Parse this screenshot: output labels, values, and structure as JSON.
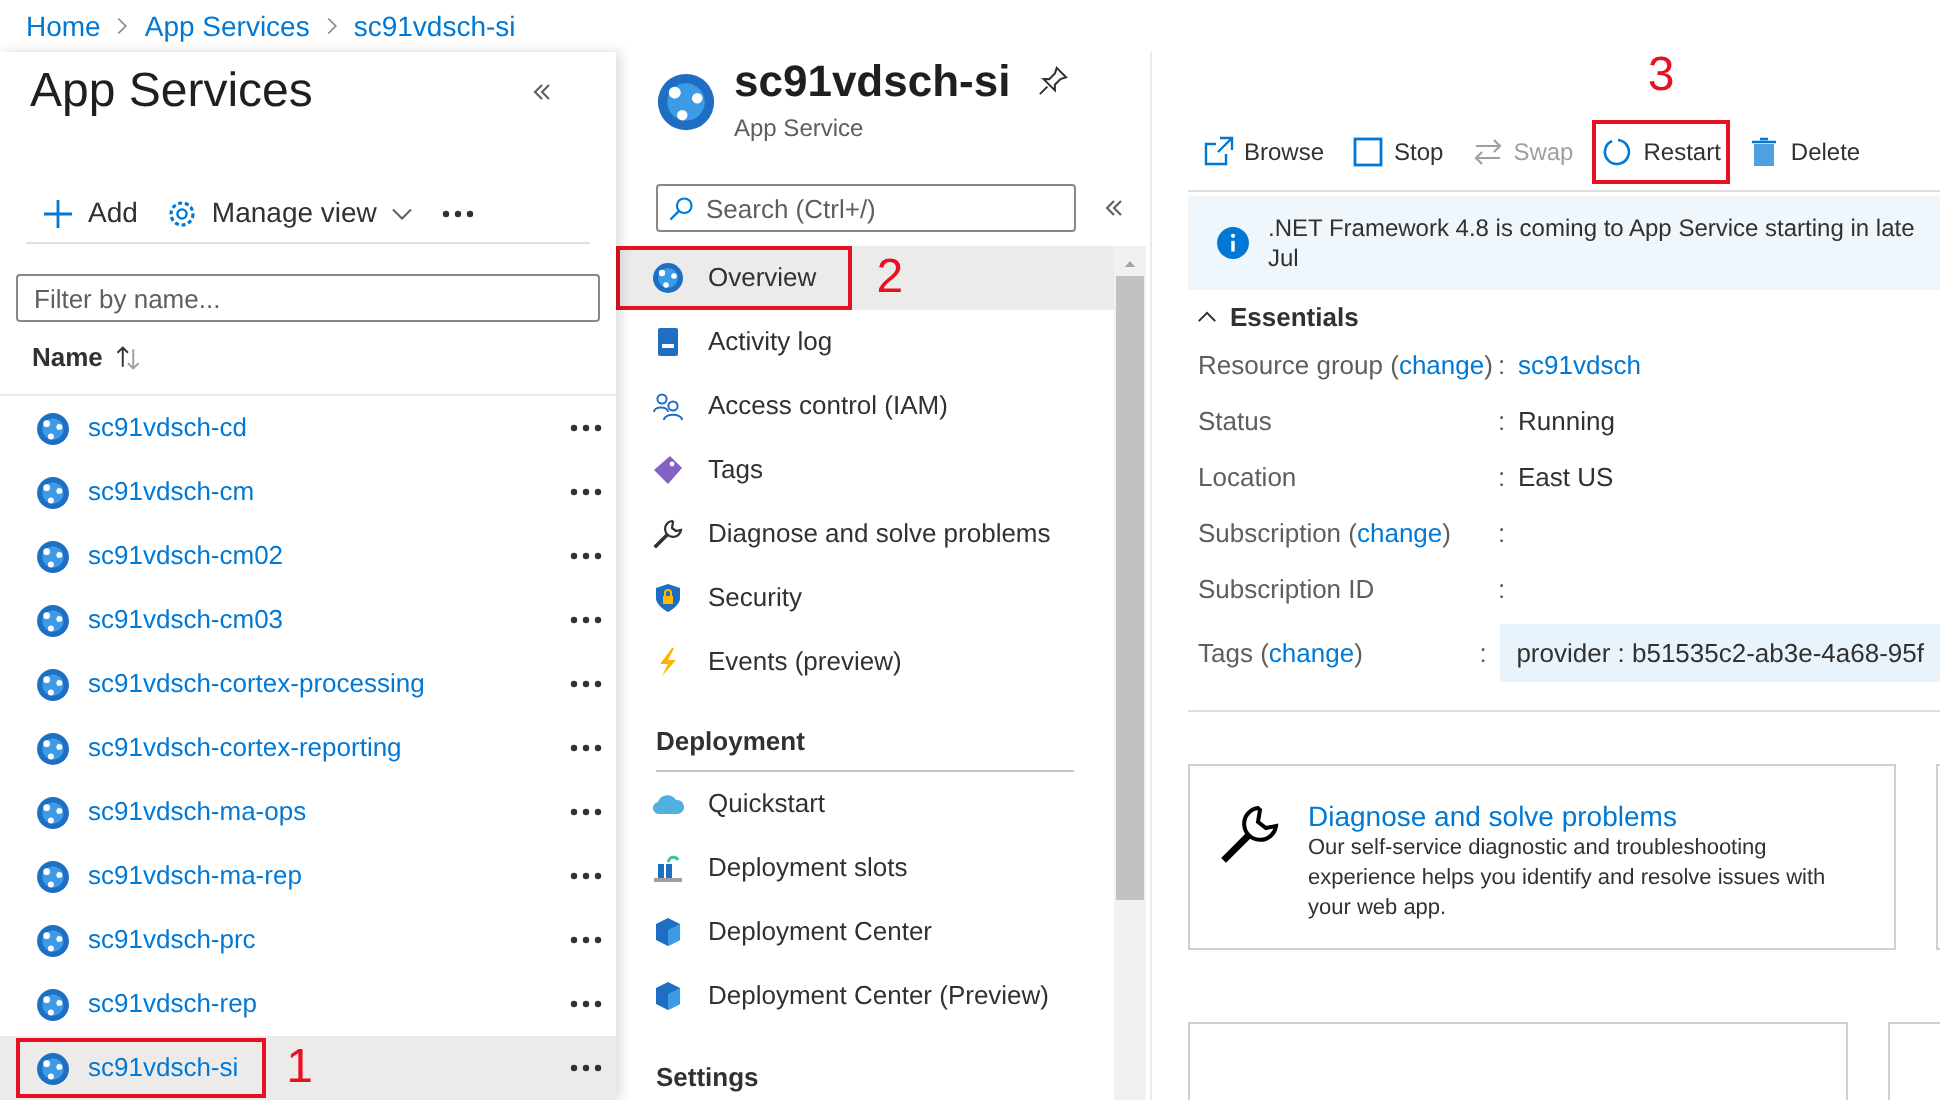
{
  "breadcrumb": [
    "Home",
    "App Services",
    "sc91vdsch-si"
  ],
  "list_blade": {
    "title": "App Services",
    "toolbar": [
      {
        "label": "Add",
        "kind": "add"
      },
      {
        "label": "Manage view",
        "kind": "manage"
      }
    ],
    "filter": {
      "placeholder": "Filter by name..."
    },
    "column": "Name",
    "rows": [
      {
        "name": "sc91vdsch-cd",
        "selected": false
      },
      {
        "name": "sc91vdsch-cm",
        "selected": false
      },
      {
        "name": "sc91vdsch-cm02",
        "selected": false
      },
      {
        "name": "sc91vdsch-cm03",
        "selected": false
      },
      {
        "name": "sc91vdsch-cortex-processing",
        "selected": false
      },
      {
        "name": "sc91vdsch-cortex-reporting",
        "selected": false
      },
      {
        "name": "sc91vdsch-ma-ops",
        "selected": false
      },
      {
        "name": "sc91vdsch-ma-rep",
        "selected": false
      },
      {
        "name": "sc91vdsch-prc",
        "selected": false
      },
      {
        "name": "sc91vdsch-rep",
        "selected": false
      },
      {
        "name": "sc91vdsch-si",
        "selected": true,
        "annotation": "1"
      }
    ]
  },
  "resource": {
    "title": "sc91vdsch-si",
    "subtitle": "App Service",
    "search": {
      "placeholder": "Search (Ctrl+/)"
    },
    "menu": [
      {
        "kind": "item",
        "label": "Overview",
        "selected": true,
        "annotation": "2"
      },
      {
        "kind": "item",
        "label": "Activity log",
        "selected": false
      },
      {
        "kind": "item",
        "label": "Access control (IAM)",
        "selected": false
      },
      {
        "kind": "item",
        "label": "Tags",
        "selected": false
      },
      {
        "kind": "item",
        "label": "Diagnose and solve problems",
        "selected": false
      },
      {
        "kind": "item",
        "label": "Security",
        "selected": false
      },
      {
        "kind": "item",
        "label": "Events (preview)",
        "selected": false
      },
      {
        "kind": "section",
        "label": "Deployment"
      },
      {
        "kind": "item",
        "label": "Quickstart",
        "selected": false
      },
      {
        "kind": "item",
        "label": "Deployment slots",
        "selected": false
      },
      {
        "kind": "item",
        "label": "Deployment Center",
        "selected": false
      },
      {
        "kind": "item",
        "label": "Deployment Center (Preview)",
        "selected": false
      },
      {
        "kind": "section",
        "label": "Settings"
      }
    ]
  },
  "overview": {
    "toolbar": [
      {
        "label": "Browse",
        "disabled": false
      },
      {
        "label": "Stop",
        "disabled": false
      },
      {
        "label": "Swap",
        "disabled": true
      },
      {
        "label": "Restart",
        "disabled": false,
        "annotation": "3"
      },
      {
        "label": "Delete",
        "disabled": false
      }
    ],
    "banner": ".NET Framework 4.8 is coming to App Service starting in late Jul",
    "essentials": {
      "label": "Essentials",
      "expanded": true,
      "rows": [
        {
          "label": "Resource group (",
          "link": "change",
          "after": ")",
          "sep": ":",
          "value": "sc91vdsch",
          "kind": "link"
        },
        {
          "label": "Status",
          "sep": ":",
          "value": "Running",
          "kind": "text"
        },
        {
          "label": "Location",
          "sep": ":",
          "value": "East US",
          "kind": "text"
        },
        {
          "label": "Subscription (",
          "link": "change",
          "after": ")",
          "sep": ":",
          "kind": "empty"
        },
        {
          "label": "Subscription ID",
          "sep": ":",
          "kind": "empty"
        },
        {
          "label": "Tags (",
          "link": "change",
          "after": ")",
          "sep": ":",
          "value": "provider : b51535c2-ab3e-4a68-95f",
          "kind": "tag"
        }
      ]
    },
    "card": {
      "title": "Diagnose and solve problems",
      "description": "Our self-service diagnostic and troubleshooting experience helps you identify and resolve issues with your web app."
    }
  }
}
